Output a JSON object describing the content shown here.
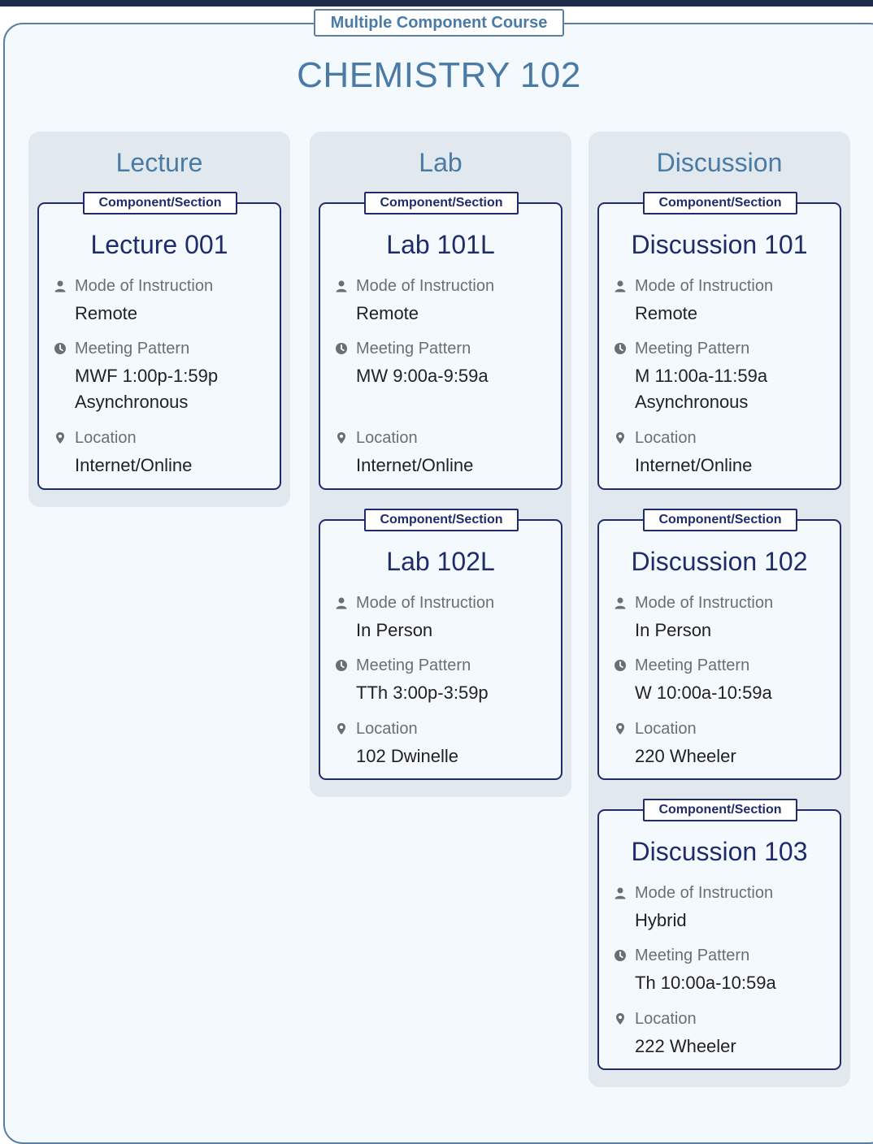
{
  "course": {
    "tag": "Multiple Component Course",
    "title": "CHEMISTRY 102"
  },
  "common": {
    "component_tag": "Component/Section",
    "mode_label": "Mode of Instruction",
    "pattern_label": "Meeting Pattern",
    "location_label": "Location"
  },
  "columns": [
    {
      "title": "Lecture",
      "sections": [
        {
          "title": "Lecture 001",
          "mode": "Remote",
          "pattern_line1": "MWF 1:00p-1:59p",
          "pattern_line2": "Asynchronous",
          "location": "Internet/Online"
        }
      ]
    },
    {
      "title": "Lab",
      "sections": [
        {
          "title": "Lab 101L",
          "mode": "Remote",
          "pattern_line1": "MW 9:00a-9:59a",
          "location": "Internet/Online"
        },
        {
          "title": "Lab 102L",
          "mode": "In Person",
          "pattern_line1": "TTh 3:00p-3:59p",
          "location": "102 Dwinelle"
        }
      ]
    },
    {
      "title": "Discussion",
      "sections": [
        {
          "title": "Discussion 101",
          "mode": "Remote",
          "pattern_line1": "M 11:00a-11:59a",
          "pattern_line2": "Asynchronous",
          "location": "Internet/Online"
        },
        {
          "title": "Discussion 102",
          "mode": "In Person",
          "pattern_line1": "W 10:00a-10:59a",
          "location": "220 Wheeler"
        },
        {
          "title": "Discussion 103",
          "mode": "Hybrid",
          "pattern_line1": "Th 10:00a-10:59a",
          "location": "222 Wheeler"
        }
      ]
    }
  ]
}
